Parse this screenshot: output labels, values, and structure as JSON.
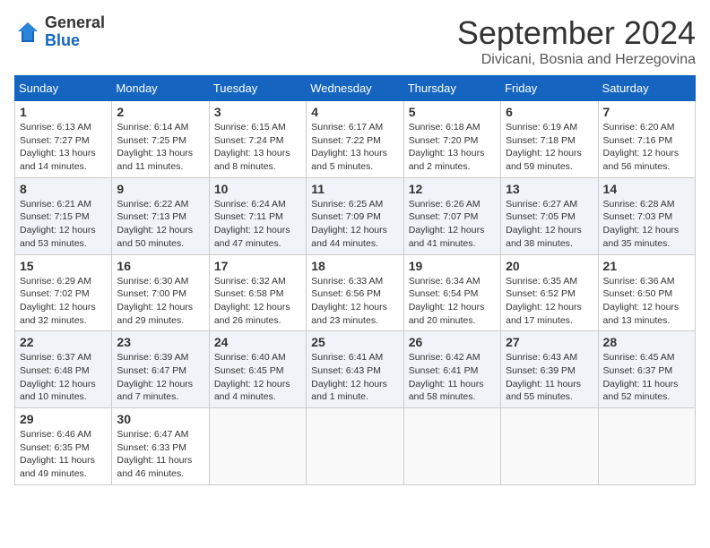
{
  "header": {
    "logo_general": "General",
    "logo_blue": "Blue",
    "month": "September 2024",
    "location": "Divicani, Bosnia and Herzegovina"
  },
  "columns": [
    "Sunday",
    "Monday",
    "Tuesday",
    "Wednesday",
    "Thursday",
    "Friday",
    "Saturday"
  ],
  "weeks": [
    [
      {
        "day": "1",
        "info": "Sunrise: 6:13 AM\nSunset: 7:27 PM\nDaylight: 13 hours and 14 minutes."
      },
      {
        "day": "2",
        "info": "Sunrise: 6:14 AM\nSunset: 7:25 PM\nDaylight: 13 hours and 11 minutes."
      },
      {
        "day": "3",
        "info": "Sunrise: 6:15 AM\nSunset: 7:24 PM\nDaylight: 13 hours and 8 minutes."
      },
      {
        "day": "4",
        "info": "Sunrise: 6:17 AM\nSunset: 7:22 PM\nDaylight: 13 hours and 5 minutes."
      },
      {
        "day": "5",
        "info": "Sunrise: 6:18 AM\nSunset: 7:20 PM\nDaylight: 13 hours and 2 minutes."
      },
      {
        "day": "6",
        "info": "Sunrise: 6:19 AM\nSunset: 7:18 PM\nDaylight: 12 hours and 59 minutes."
      },
      {
        "day": "7",
        "info": "Sunrise: 6:20 AM\nSunset: 7:16 PM\nDaylight: 12 hours and 56 minutes."
      }
    ],
    [
      {
        "day": "8",
        "info": "Sunrise: 6:21 AM\nSunset: 7:15 PM\nDaylight: 12 hours and 53 minutes."
      },
      {
        "day": "9",
        "info": "Sunrise: 6:22 AM\nSunset: 7:13 PM\nDaylight: 12 hours and 50 minutes."
      },
      {
        "day": "10",
        "info": "Sunrise: 6:24 AM\nSunset: 7:11 PM\nDaylight: 12 hours and 47 minutes."
      },
      {
        "day": "11",
        "info": "Sunrise: 6:25 AM\nSunset: 7:09 PM\nDaylight: 12 hours and 44 minutes."
      },
      {
        "day": "12",
        "info": "Sunrise: 6:26 AM\nSunset: 7:07 PM\nDaylight: 12 hours and 41 minutes."
      },
      {
        "day": "13",
        "info": "Sunrise: 6:27 AM\nSunset: 7:05 PM\nDaylight: 12 hours and 38 minutes."
      },
      {
        "day": "14",
        "info": "Sunrise: 6:28 AM\nSunset: 7:03 PM\nDaylight: 12 hours and 35 minutes."
      }
    ],
    [
      {
        "day": "15",
        "info": "Sunrise: 6:29 AM\nSunset: 7:02 PM\nDaylight: 12 hours and 32 minutes."
      },
      {
        "day": "16",
        "info": "Sunrise: 6:30 AM\nSunset: 7:00 PM\nDaylight: 12 hours and 29 minutes."
      },
      {
        "day": "17",
        "info": "Sunrise: 6:32 AM\nSunset: 6:58 PM\nDaylight: 12 hours and 26 minutes."
      },
      {
        "day": "18",
        "info": "Sunrise: 6:33 AM\nSunset: 6:56 PM\nDaylight: 12 hours and 23 minutes."
      },
      {
        "day": "19",
        "info": "Sunrise: 6:34 AM\nSunset: 6:54 PM\nDaylight: 12 hours and 20 minutes."
      },
      {
        "day": "20",
        "info": "Sunrise: 6:35 AM\nSunset: 6:52 PM\nDaylight: 12 hours and 17 minutes."
      },
      {
        "day": "21",
        "info": "Sunrise: 6:36 AM\nSunset: 6:50 PM\nDaylight: 12 hours and 13 minutes."
      }
    ],
    [
      {
        "day": "22",
        "info": "Sunrise: 6:37 AM\nSunset: 6:48 PM\nDaylight: 12 hours and 10 minutes."
      },
      {
        "day": "23",
        "info": "Sunrise: 6:39 AM\nSunset: 6:47 PM\nDaylight: 12 hours and 7 minutes."
      },
      {
        "day": "24",
        "info": "Sunrise: 6:40 AM\nSunset: 6:45 PM\nDaylight: 12 hours and 4 minutes."
      },
      {
        "day": "25",
        "info": "Sunrise: 6:41 AM\nSunset: 6:43 PM\nDaylight: 12 hours and 1 minute."
      },
      {
        "day": "26",
        "info": "Sunrise: 6:42 AM\nSunset: 6:41 PM\nDaylight: 11 hours and 58 minutes."
      },
      {
        "day": "27",
        "info": "Sunrise: 6:43 AM\nSunset: 6:39 PM\nDaylight: 11 hours and 55 minutes."
      },
      {
        "day": "28",
        "info": "Sunrise: 6:45 AM\nSunset: 6:37 PM\nDaylight: 11 hours and 52 minutes."
      }
    ],
    [
      {
        "day": "29",
        "info": "Sunrise: 6:46 AM\nSunset: 6:35 PM\nDaylight: 11 hours and 49 minutes."
      },
      {
        "day": "30",
        "info": "Sunrise: 6:47 AM\nSunset: 6:33 PM\nDaylight: 11 hours and 46 minutes."
      },
      {
        "day": "",
        "info": ""
      },
      {
        "day": "",
        "info": ""
      },
      {
        "day": "",
        "info": ""
      },
      {
        "day": "",
        "info": ""
      },
      {
        "day": "",
        "info": ""
      }
    ]
  ]
}
